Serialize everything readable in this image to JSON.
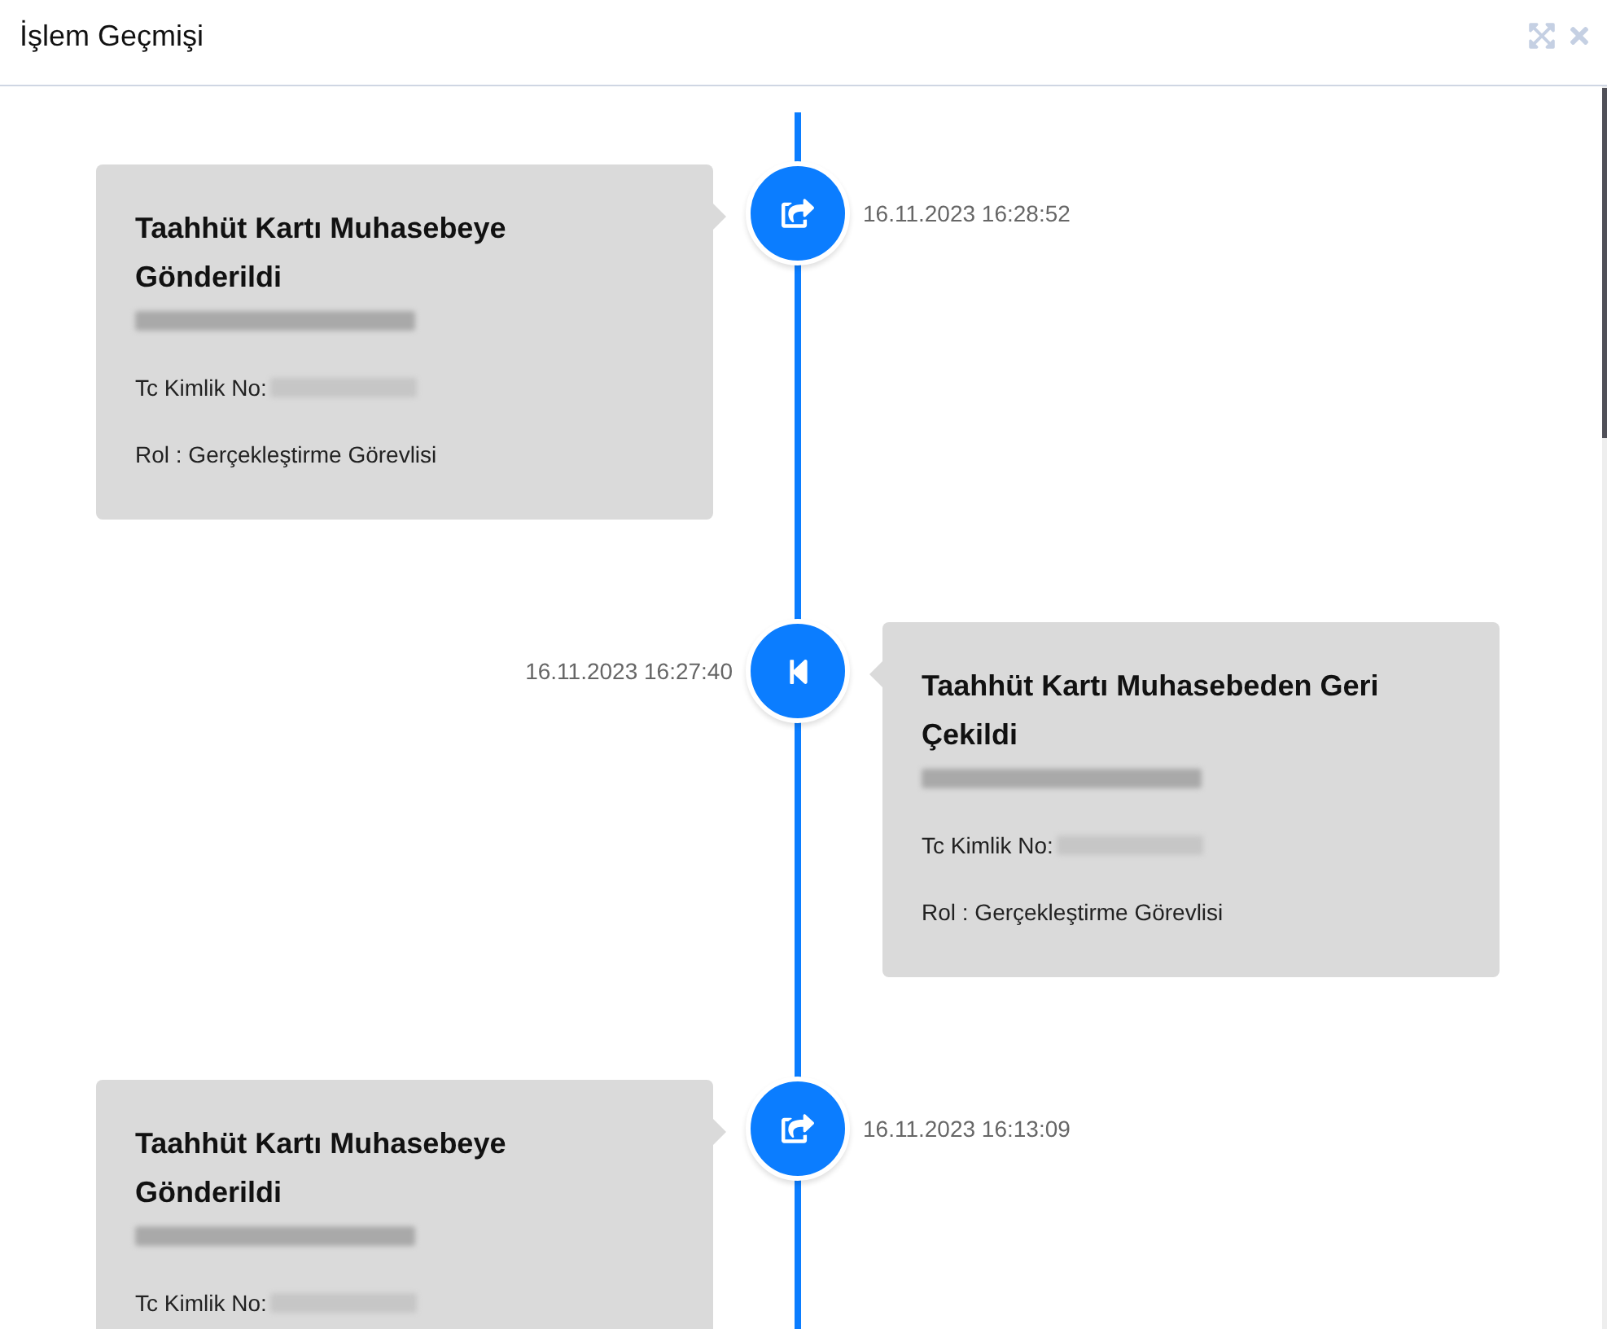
{
  "dialog": {
    "title": "İşlem Geçmişi"
  },
  "events": [
    {
      "kind": "sent",
      "title": "Taahhüt Kartı Muhasebeye Gönderildi",
      "timestamp": "16.11.2023 16:28:52",
      "id_label": "Tc Kimlik No:",
      "role": "Rol : Gerçekleştirme Görevlisi"
    },
    {
      "kind": "withdrawn",
      "title": "Taahhüt Kartı Muhasebeden Geri Çekildi",
      "timestamp": "16.11.2023 16:27:40",
      "id_label": "Tc Kimlik No:",
      "role": "Rol : Gerçekleştirme Görevlisi"
    },
    {
      "kind": "sent",
      "title": "Taahhüt Kartı Muhasebeye Gönderildi",
      "timestamp": "16.11.2023 16:13:09",
      "id_label": "Tc Kimlik No:"
    }
  ]
}
